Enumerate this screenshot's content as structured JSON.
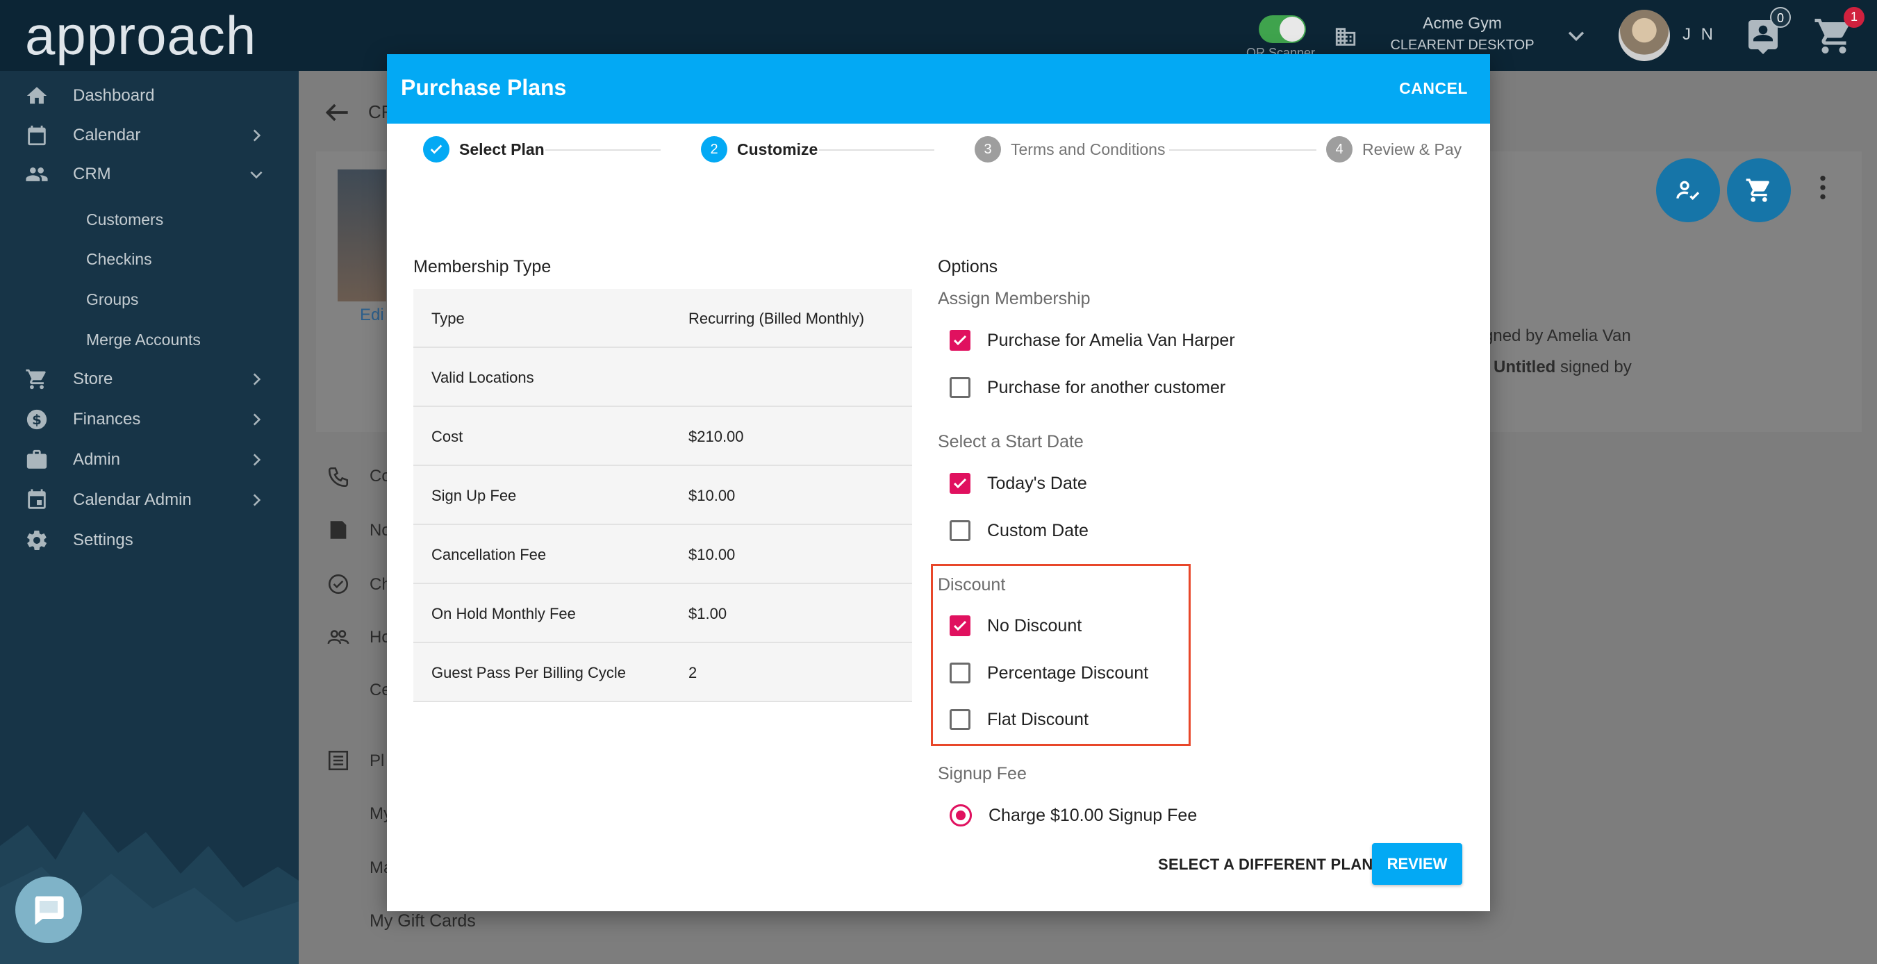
{
  "app": {
    "logo_text": "approach",
    "qr_label": "QR Scanner",
    "gym_name": "Acme Gym",
    "gym_device": "CLEARENT DESKTOP SWIPER",
    "user_initials": "J N",
    "inbox_count": "0",
    "cart_count": "1"
  },
  "sidebar": {
    "items": [
      {
        "label": "Dashboard",
        "icon": "home-icon"
      },
      {
        "label": "Calendar",
        "icon": "calendar-icon"
      },
      {
        "label": "CRM",
        "icon": "people-icon"
      },
      {
        "label": "Store",
        "icon": "cart-icon"
      },
      {
        "label": "Finances",
        "icon": "dollar-icon"
      },
      {
        "label": "Admin",
        "icon": "briefcase-icon"
      },
      {
        "label": "Calendar Admin",
        "icon": "event-icon"
      },
      {
        "label": "Settings",
        "icon": "gear-icon"
      }
    ],
    "crm_sub": [
      "Customers",
      "Checkins",
      "Groups",
      "Merge Accounts"
    ]
  },
  "background": {
    "crumb": "CR",
    "edit_link": "Edi",
    "signed_line1": "gned by Amelia Van",
    "signed_line2_bold": "Untitled",
    "signed_line2_rest": " signed by",
    "left_items": [
      "Co",
      "No",
      "Ch",
      "Ho",
      "Ce",
      "Pl",
      "My",
      "Ma"
    ],
    "gift_cards": "My Gift Cards"
  },
  "modal": {
    "title": "Purchase Plans",
    "cancel_label": "CANCEL",
    "steps": [
      {
        "number": "",
        "label": "Select Plan",
        "state": "done"
      },
      {
        "number": "2",
        "label": "Customize",
        "state": "active"
      },
      {
        "number": "3",
        "label": "Terms and Conditions",
        "state": "inactive"
      },
      {
        "number": "4",
        "label": "Review & Pay",
        "state": "inactive"
      }
    ],
    "membership": {
      "heading": "Membership Type",
      "rows": [
        {
          "key": "Type",
          "value": "Recurring (Billed Monthly)"
        },
        {
          "key": "Valid Locations",
          "value": ""
        },
        {
          "key": "Cost",
          "value": "$210.00"
        },
        {
          "key": "Sign Up Fee",
          "value": "$10.00"
        },
        {
          "key": "Cancellation Fee",
          "value": "$10.00"
        },
        {
          "key": "On Hold Monthly Fee",
          "value": "$1.00"
        },
        {
          "key": "Guest Pass Per Billing Cycle",
          "value": "2"
        }
      ]
    },
    "options": {
      "heading": "Options",
      "assign_label": "Assign Membership",
      "assign_self": "Purchase for Amelia Van Harper",
      "assign_other": "Purchase for another customer",
      "start_label": "Select a Start Date",
      "start_today": "Today's Date",
      "start_custom": "Custom Date",
      "discount_label": "Discount",
      "discount_none": "No Discount",
      "discount_percentage": "Percentage Discount",
      "discount_flat": "Flat Discount",
      "signup_label": "Signup Fee",
      "signup_charge": "Charge $10.00 Signup Fee"
    },
    "footer": {
      "different_plan": "SELECT A DIFFERENT PLAN",
      "review": "REVIEW"
    }
  },
  "colors": {
    "header_blue": "#03a9f4",
    "checkbox_pink": "#e0115f",
    "highlight_red": "#e8472a",
    "sidebar_bg": "#173447"
  }
}
